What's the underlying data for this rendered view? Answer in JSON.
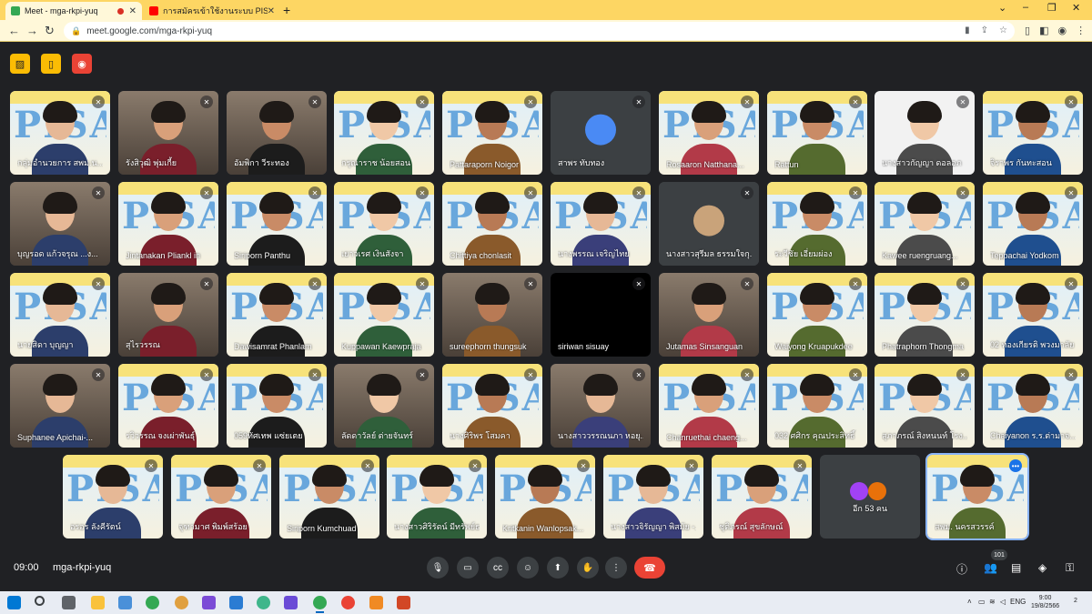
{
  "browser": {
    "tabs": [
      {
        "title": "Meet - mga-rkpi-yuq",
        "active": true,
        "recording": true
      },
      {
        "title": "การสมัครเข้าใช้งานระบบ PISA STYLE",
        "active": false
      }
    ],
    "new_tab_symbol": "+",
    "window_controls": [
      "chevron-down-icon",
      "minimize-icon",
      "restore-icon",
      "close-icon"
    ],
    "url": "meet.google.com/mga-rkpi-yuq"
  },
  "meeting": {
    "time": "09:00",
    "code": "mga-rkpi-yuq",
    "participant_count": "101",
    "others_label": "อีก 53 คน",
    "top_buttons": [
      "no-camera-icon",
      "door-icon",
      "record-icon"
    ],
    "controls": [
      "mic-icon",
      "camera-icon",
      "captions-icon",
      "emoji-icon",
      "present-icon",
      "raise-hand-icon",
      "more-icon"
    ],
    "right_icons": [
      "info-icon",
      "people-icon",
      "chat-icon",
      "activities-icon",
      "lock-icon"
    ]
  },
  "participants": [
    {
      "name": "กลุ่มอำนวยการ สพม.น...",
      "bg": "pisa"
    },
    {
      "name": "รังสิวุฒิ พุ่มเกี้ย",
      "bg": "room"
    },
    {
      "name": "อัมพิกา วีระทอง",
      "bg": "room"
    },
    {
      "name": "กรุณาราช น้อยสอน",
      "bg": "pisa"
    },
    {
      "name": "Pattaraporn Noigor",
      "bg": "pisa"
    },
    {
      "name": "สาพร ทับทอง",
      "bg": "avatar"
    },
    {
      "name": "Rosaaron Natthana...",
      "bg": "pisa"
    },
    {
      "name": "Rattun",
      "bg": "pisa"
    },
    {
      "name": "นางสาวกัญญา ดอลอภ",
      "bg": "light"
    },
    {
      "name": "จิราพร กันทะสอน",
      "bg": "pisa"
    },
    {
      "name": "บุญรอด แก้วจรุณ ...ง...",
      "bg": "room"
    },
    {
      "name": "Jintanakan Pliankl in",
      "bg": "pisa"
    },
    {
      "name": "Siriporn Panthu",
      "bg": "pisa"
    },
    {
      "name": "เยาวเรศ เงินสังจา",
      "bg": "pisa"
    },
    {
      "name": "Chittiya chonlasit",
      "bg": "pisa"
    },
    {
      "name": "นางพรรณ เจริญไทย",
      "bg": "pisa"
    },
    {
      "name": "นางสาวสุรีมล ธรรมใจกุ...",
      "bg": "avatar"
    },
    {
      "name": "ระวีชัย เอี่ยมผ่อง",
      "bg": "pisa"
    },
    {
      "name": "Kawee ruengruang...",
      "bg": "pisa"
    },
    {
      "name": "Teppachai Yodkom",
      "bg": "pisa"
    },
    {
      "name": "นายสิดา บุญญา",
      "bg": "pisa"
    },
    {
      "name": "สุไรวรรณ",
      "bg": "room"
    },
    {
      "name": "Dawisamrat Phanlam",
      "bg": "pisa"
    },
    {
      "name": "Kuppawan Kaewpraja",
      "bg": "pisa"
    },
    {
      "name": "sureephorn thungsuk",
      "bg": "room"
    },
    {
      "name": "siriwan sisuay",
      "bg": "black"
    },
    {
      "name": "Jutamas Sinsanguan",
      "bg": "room"
    },
    {
      "name": "Waiyong Kruapukdee",
      "bg": "pisa"
    },
    {
      "name": "Phatraphorn Thongma",
      "bg": "pisa"
    },
    {
      "name": "02 ทองเกียรติ พวงมาลัย",
      "bg": "pisa"
    },
    {
      "name": "Suphanee Apichai-...",
      "bg": "room"
    },
    {
      "name": "รวิวรรณ จงเผ่าพันธุ์",
      "bg": "pisa"
    },
    {
      "name": "059ทัศเทพ แซ่ยเตย",
      "bg": "pisa"
    },
    {
      "name": "ลัดดาวัลย์ ต่ายจันทร์",
      "bg": "room"
    },
    {
      "name": "นางศิริพร โสมคา",
      "bg": "pisa"
    },
    {
      "name": "นางสาววรรณนภา หอยุ...",
      "bg": "room"
    },
    {
      "name": "Chanruethai chaeng...",
      "bg": "pisa"
    },
    {
      "name": "032 ศศิกร คุณประสิทธิ์",
      "bg": "pisa"
    },
    {
      "name": "สุภาภรณ์ สิงหนนท์ โรง...",
      "bg": "pisa"
    },
    {
      "name": "Chaiyanon ร.ร.ต่ามาจ...",
      "bg": "pisa"
    },
    {
      "name": "อรอร ลังคีรัตน์",
      "bg": "pisa"
    },
    {
      "name": "จุฑามาศ พิมพ์สร้อย",
      "bg": "pisa"
    },
    {
      "name": "Siriporn Kumchuad",
      "bg": "pisa"
    },
    {
      "name": "นางสาวศิริรัตน์ มีทรัพย์ธร...",
      "bg": "pisa"
    },
    {
      "name": "Kritkanin Wanlopsak...",
      "bg": "pisa"
    },
    {
      "name": "นางสาวจิรัญญา พิสมัย -...",
      "bg": "pisa"
    },
    {
      "name": "ชุติภรณ์ สุขลักษณ์",
      "bg": "pisa"
    },
    {
      "name": "สพม. นครสวรรค์",
      "bg": "pisa",
      "selected": true
    }
  ],
  "taskbar": {
    "language": "ENG",
    "time": "9:00",
    "date": "19/8/2566",
    "notifications": "2"
  },
  "colors": {
    "meet_bg": "#202124",
    "tile_bg": "#3c4043",
    "hangup": "#ea4335",
    "tab_strip": "#fdd663",
    "accent": "#1a73e8"
  }
}
